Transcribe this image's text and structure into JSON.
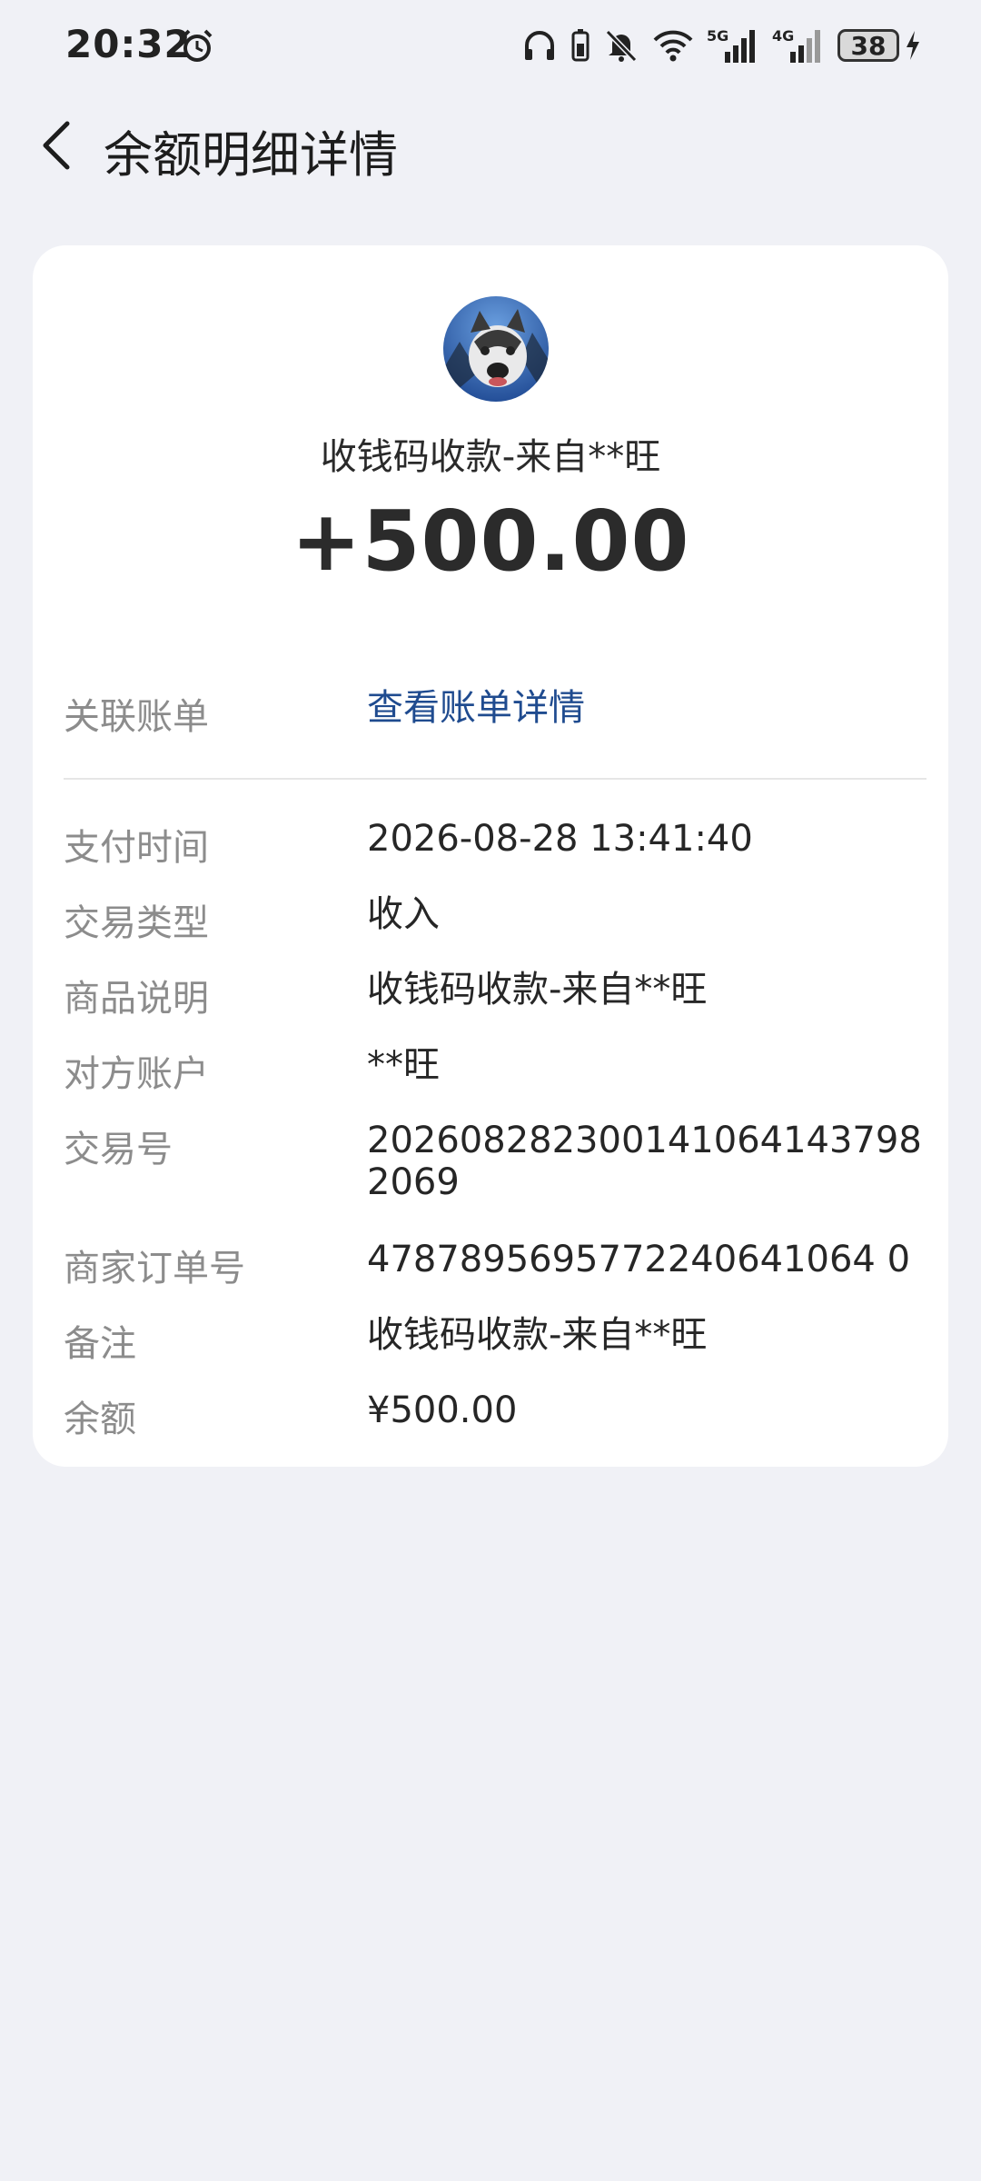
{
  "status_bar": {
    "time": "20:32",
    "icons": [
      "alarm-icon",
      "headphones-icon",
      "battery-saver-icon",
      "mute-icon",
      "wifi-icon",
      "5g-signal-icon",
      "4g-signal-icon",
      "battery-icon",
      "charging-icon"
    ],
    "net_5g": "5G",
    "net_4g": "4G",
    "battery": "38"
  },
  "header": {
    "title": "余额明细详情"
  },
  "summary": {
    "merchant": "收钱码收款-来自**旺",
    "amount": "+500.00"
  },
  "linked_bill": {
    "label": "关联账单",
    "link_text": "查看账单详情",
    "link_color": "#1f4b8f"
  },
  "details": [
    {
      "label": "支付时间",
      "value": "2026-08-28 13:41:40"
    },
    {
      "label": "交易类型",
      "value": "收入"
    },
    {
      "label": "商品说明",
      "value": "收钱码收款-来自**旺"
    },
    {
      "label": "对方账户",
      "value": "**旺"
    },
    {
      "label": "交易号",
      "value": "2026082823001410641437982069"
    },
    {
      "label": "商家订单号",
      "value": "4787895695772240641064 0"
    },
    {
      "label": "备注",
      "value": "收钱码收款-来自**旺"
    },
    {
      "label": "余额",
      "value": "¥500.00"
    }
  ],
  "colors": {
    "background": "#f0f1f6",
    "card": "#ffffff",
    "label_gray": "#8c8c8c"
  }
}
